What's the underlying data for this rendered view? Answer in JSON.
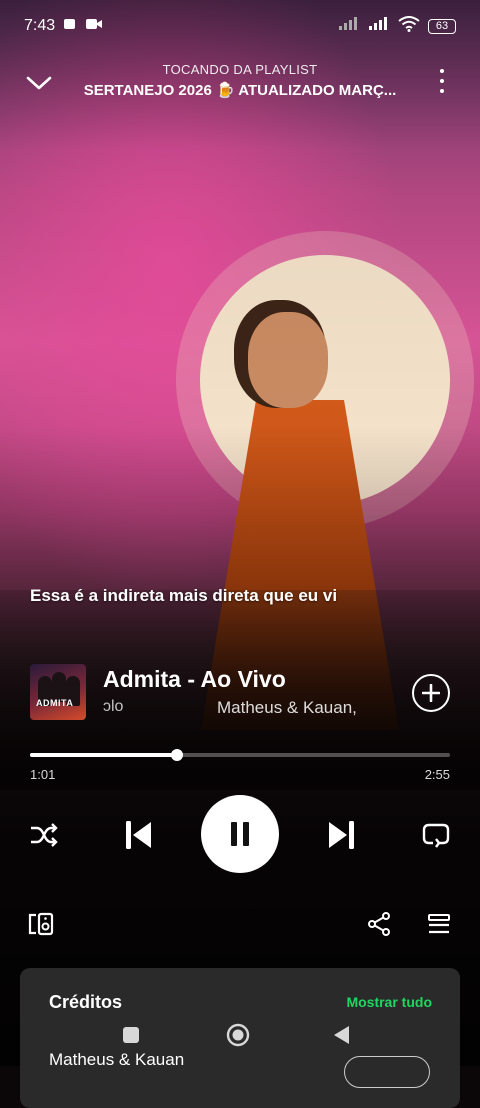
{
  "status_bar": {
    "time": "7:43",
    "battery": "63"
  },
  "header": {
    "subtitle": "TOCANDO DA PLAYLIST",
    "playlist": "SERTANEJO 2026 🍺 ATUALIZADO MARÇ..."
  },
  "lyric": "Essa é a indireta mais direta que eu vi",
  "track": {
    "title": "Admita - Ao Vivo",
    "scrolling_fragment": "ɔlo",
    "artist": "Matheus & Kauan,",
    "cover_text": "ADMITA"
  },
  "playback": {
    "current_time": "1:01",
    "total_time": "2:55",
    "progress": 0.35
  },
  "icons": {
    "collapse": "chevron-down-icon",
    "more": "more-vertical-icon",
    "add": "add-circle-icon",
    "shuffle": "shuffle-icon",
    "previous": "skip-previous-icon",
    "pause": "pause-icon",
    "next": "skip-next-icon",
    "repeat": "repeat-icon",
    "devices": "connect-devices-icon",
    "share": "share-icon",
    "queue": "queue-icon"
  },
  "credits": {
    "title": "Créditos",
    "show_all": "Mostrar tudo",
    "artist": "Matheus & Kauan"
  },
  "colors": {
    "accent_green": "#1ed760",
    "card_bg": "#2b2a2b"
  }
}
